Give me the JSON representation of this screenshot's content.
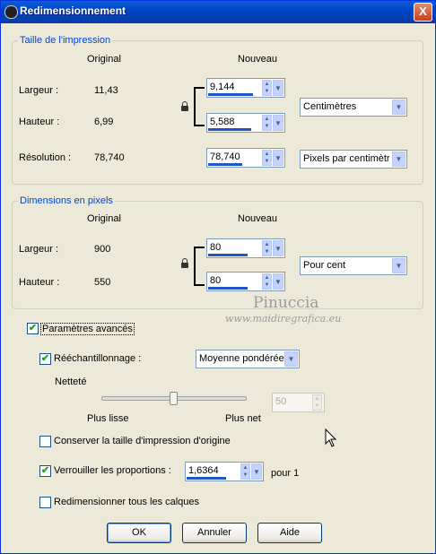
{
  "window": {
    "title": "Redimensionnement",
    "close_label": "X"
  },
  "print_size": {
    "legend": "Taille de l'impression",
    "col_original": "Original",
    "col_new": "Nouveau",
    "width_label": "Largeur :",
    "width_original": "11,43",
    "width_new": "9,144",
    "height_label": "Hauteur :",
    "height_original": "6,99",
    "height_new": "5,588",
    "resolution_label": "Résolution :",
    "resolution_original": "78,740",
    "resolution_new": "78,740",
    "unit_select": "Centimètres",
    "resolution_unit_select": "Pixels par centimètre"
  },
  "pixel_dims": {
    "legend": "Dimensions en pixels",
    "col_original": "Original",
    "col_new": "Nouveau",
    "width_label": "Largeur :",
    "width_original": "900",
    "width_new": "80",
    "height_label": "Hauteur :",
    "height_original": "550",
    "height_new": "80",
    "unit_select": "Pour cent"
  },
  "advanced": {
    "advanced_label": "Paramètres avancés",
    "resample_label": "Rééchantillonnage :",
    "resample_select": "Moyenne pondérée",
    "sharpness_label": "Netteté",
    "smoother_label": "Plus lisse",
    "sharper_label": "Plus net",
    "sharpness_value": "50",
    "keep_print_size_label": "Conserver la taille d'impression d'origine",
    "lock_ratio_label": "Verrouiller les proportions :",
    "ratio_value": "1,6364",
    "ratio_suffix": "pour 1",
    "resize_all_layers_label": "Redimensionner tous les calques"
  },
  "buttons": {
    "ok": "OK",
    "cancel": "Annuler",
    "help": "Aide"
  },
  "watermark": {
    "line1": "Pinuccia",
    "line2": "www.maidiregrafica.eu"
  }
}
